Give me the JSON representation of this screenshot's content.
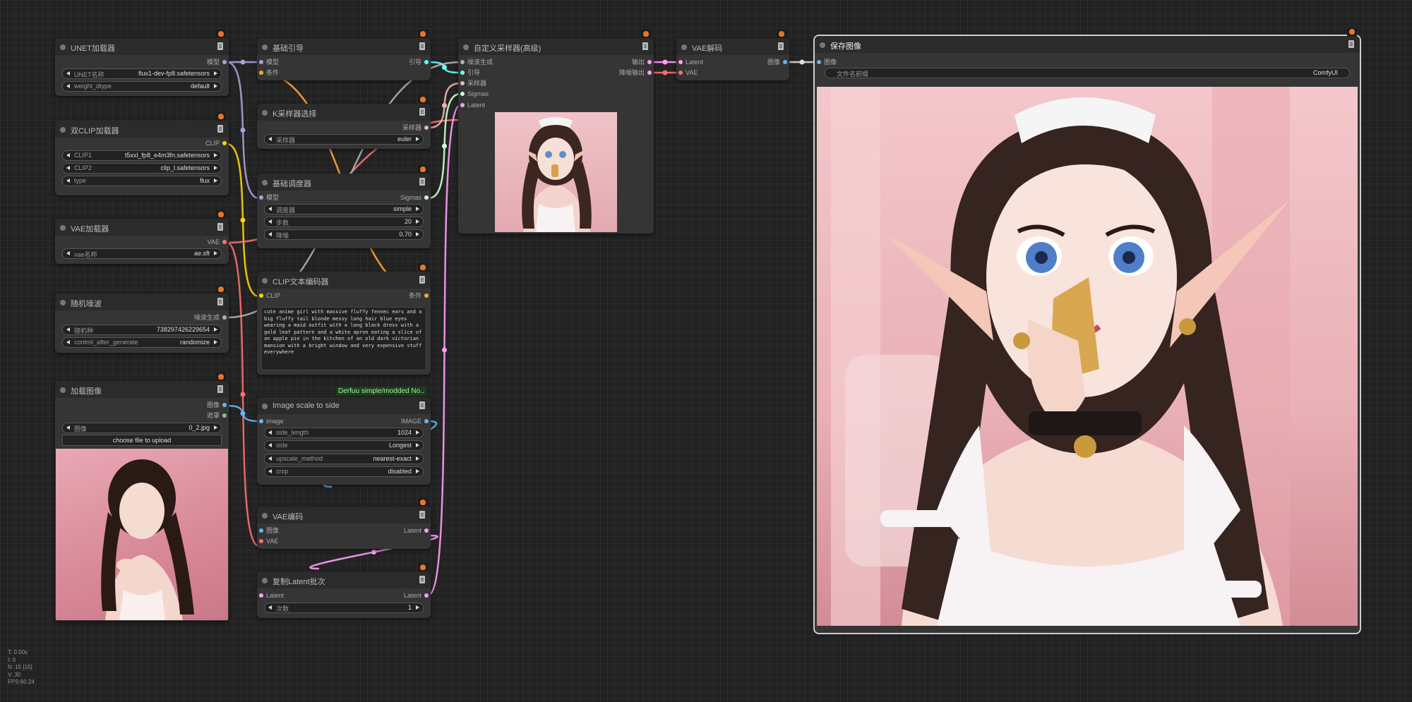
{
  "colors": {
    "model": "#b39ddb",
    "clip": "#ffd500",
    "vae": "#ff6e6e",
    "conditioning": "#ffa931",
    "latent": "#ff9cf9",
    "image": "#64b5f6",
    "noise": "#b0b0b0",
    "sampler": "#ecb4b4",
    "sigmas": "#cdffcd",
    "guider": "#66ffff",
    "mask": "#81c784"
  },
  "nodes": {
    "unet": {
      "title": "UNET加载器",
      "out_model": "模型",
      "w1_label": "UNET名称",
      "w1_value": "flux1-dev-fp8.safetensors",
      "w2_label": "weight_dtype",
      "w2_value": "default"
    },
    "dualclip": {
      "title": "双CLIP加载器",
      "out_clip": "CLIP",
      "w1_label": "CLIP1",
      "w1_value": "t5xxl_fp8_e4m3fn.safetensors",
      "w2_label": "CLIP2",
      "w2_value": "clip_l.safetensors",
      "w3_label": "type",
      "w3_value": "flux"
    },
    "vaeloader": {
      "title": "VAE加载器",
      "out_vae": "VAE",
      "w1_label": "vae名称",
      "w1_value": "ae.sft"
    },
    "noise": {
      "title": "随机噪波",
      "out_noise": "噪波生成",
      "w1_label": "随机种",
      "w1_value": "738297426229654",
      "w2_label": "control_after_generate",
      "w2_value": "randomize"
    },
    "loadimage": {
      "title": "加载图像",
      "out_image": "图像",
      "out_mask": "遮罩",
      "w1_label": "图像",
      "w1_value": "0_2.jpg",
      "button": "choose file to upload"
    },
    "guider": {
      "title": "基础引导",
      "in_model": "模型",
      "in_cond": "条件",
      "out_guider": "引导"
    },
    "ksampler": {
      "title": "K采样器选择",
      "out_sampler": "采样器",
      "w1_label": "采样器",
      "w1_value": "euler"
    },
    "scheduler": {
      "title": "基础调度器",
      "in_model": "模型",
      "out_sigmas": "Sigmas",
      "w1_label": "调度器",
      "w1_value": "simple",
      "w2_label": "步数",
      "w2_value": "20",
      "w3_label": "降噪",
      "w3_value": "0.70"
    },
    "clipencode": {
      "title": "CLIP文本编码器",
      "in_clip": "CLIP",
      "out_cond": "条件",
      "text": "cute anime girl with massive fluffy fennec ears and a big fluffy tail blonde messy long hair blue eyes wearing a maid outfit with a long black dress with a gold leaf pattern and a white apron eating a slice of an apple pie in the kitchen of an old dark victorian mansion with a bright window and very expensive stuff everywhere"
    },
    "scale": {
      "tag": "Derfuu simple/modded No..",
      "title": "Image scale to side",
      "in_image": "image",
      "out_image": "IMAGE",
      "w1_label": "side_length",
      "w1_value": "1024",
      "w2_label": "side",
      "w2_value": "Longest",
      "w3_label": "upscale_method",
      "w3_value": "nearest-exact",
      "w4_label": "crop",
      "w4_value": "disabled"
    },
    "vaeencode": {
      "title": "VAE编码",
      "in_image": "图像",
      "in_vae": "VAE",
      "out_latent": "Latent"
    },
    "repeat": {
      "title": "复制Latent批次",
      "in_latent": "Latent",
      "out_latent": "Latent",
      "w1_label": "次数",
      "w1_value": "1"
    },
    "customsampler": {
      "title": "自定义采样器(高级)",
      "in_noise": "噪波生成",
      "in_guider": "引导",
      "in_sampler": "采样器",
      "in_sigmas": "Sigmas",
      "in_latent": "Latent",
      "out_output": "输出",
      "out_denoised": "降噪输出"
    },
    "vaedecode": {
      "title": "VAE解码",
      "in_latent": "Latent",
      "in_vae": "VAE",
      "out_image": "图像"
    },
    "save": {
      "title": "保存图像",
      "in_image": "图像",
      "w1_label": "文件名前缀",
      "w1_value": "ComfyUI"
    }
  },
  "stats": {
    "t": "T: 0.00s",
    "i": "I: 0",
    "n": "N: 15 [15]",
    "v": "V: 30",
    "fps": "FPS:60.24"
  }
}
